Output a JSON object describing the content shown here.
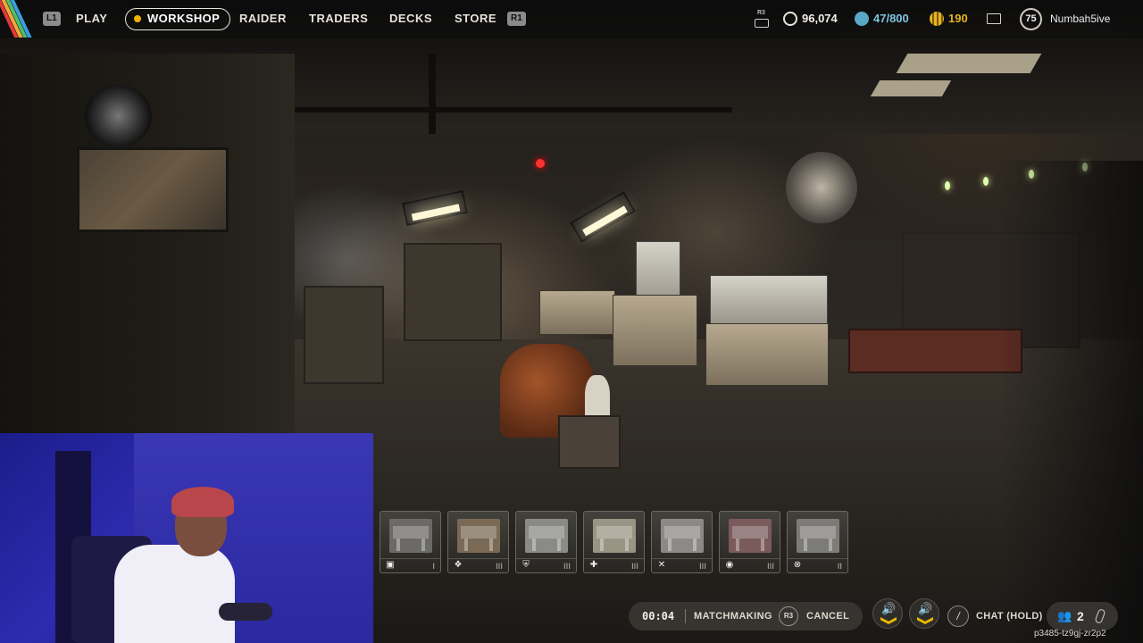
{
  "nav": {
    "left_bumper": "L1",
    "right_bumper": "R1",
    "items": [
      {
        "label": "PLAY"
      },
      {
        "label": "WORKSHOP",
        "active": true
      },
      {
        "label": "RAIDER"
      },
      {
        "label": "TRADERS"
      },
      {
        "label": "DECKS"
      },
      {
        "label": "STORE"
      }
    ]
  },
  "currency": {
    "r3_hint": "R3",
    "coins": "96,074",
    "stash": "47/800",
    "credits": "190"
  },
  "player": {
    "level": "75",
    "name": "Numbah5ive"
  },
  "workshop": {
    "stations": [
      {
        "icon": "stash-icon",
        "level": "I"
      },
      {
        "icon": "gunsmith-icon",
        "level": "III"
      },
      {
        "icon": "gear-bench-icon",
        "level": "III"
      },
      {
        "icon": "medical-icon",
        "level": "III"
      },
      {
        "icon": "explosives-icon",
        "level": "III"
      },
      {
        "icon": "utility-icon",
        "level": "III"
      },
      {
        "icon": "refiner-icon",
        "level": "II"
      }
    ]
  },
  "matchmaking": {
    "timer": "00:04",
    "label": "MATCHMAKING",
    "cancel_hint": "R3",
    "cancel_label": "CANCEL"
  },
  "chat": {
    "label": "CHAT (HOLD)"
  },
  "party": {
    "count": "2"
  },
  "session_id": "p3485-tz9gj-zr2p2",
  "colors": {
    "accent_yellow": "#f0b400",
    "stash_blue": "#5aa8c8",
    "credits_gold": "#e6b422"
  }
}
